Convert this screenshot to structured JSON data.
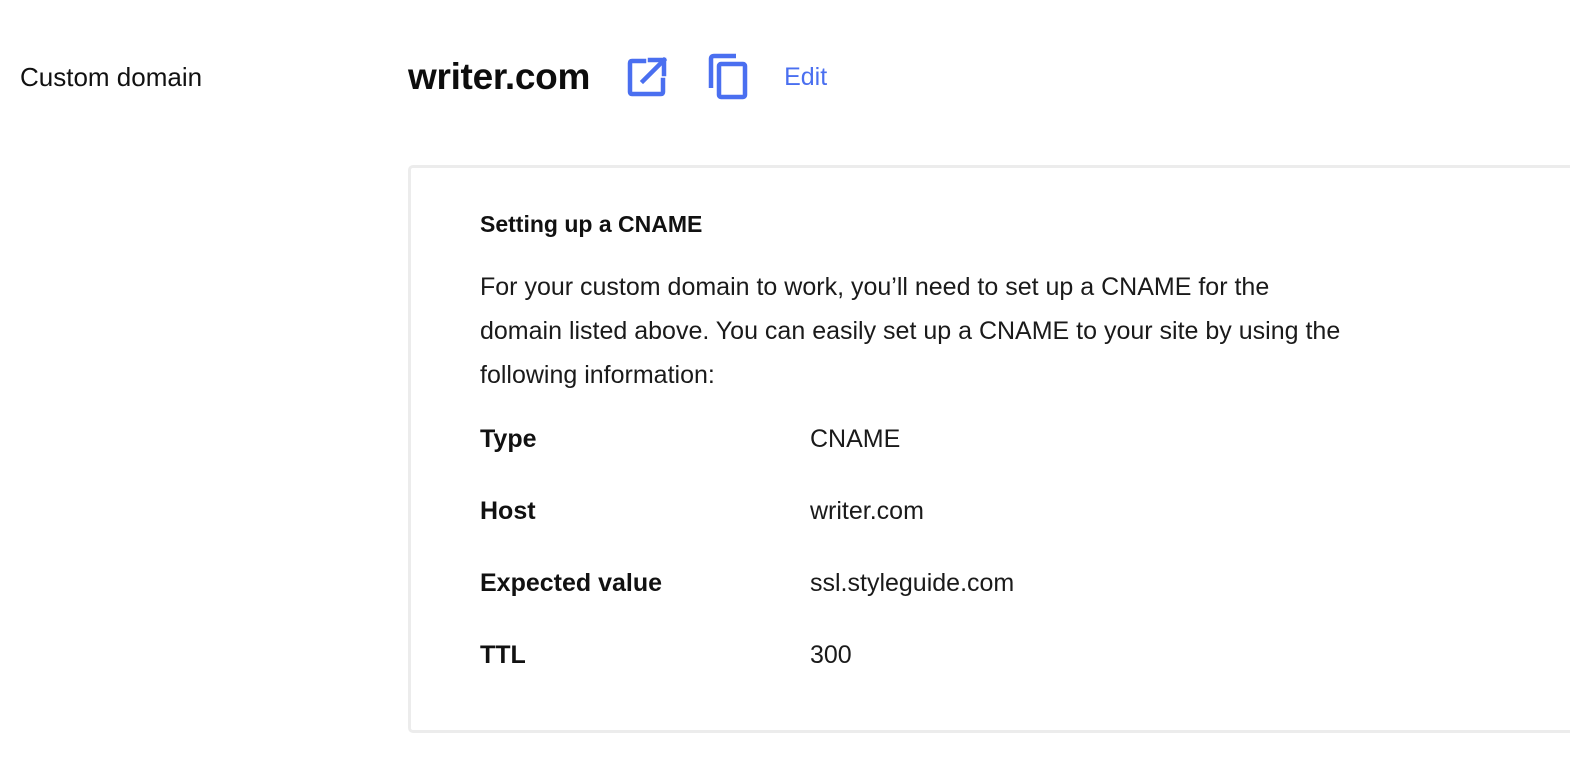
{
  "row": {
    "label": "Custom domain"
  },
  "domain": {
    "name": "writer.com",
    "edit_label": "Edit"
  },
  "icons": {
    "open": "open-in-new-icon",
    "copy": "copy-icon"
  },
  "colors": {
    "accent": "#4a6ff0",
    "card_border": "#ececec"
  },
  "card": {
    "title": "Setting up a CNAME",
    "description": "For your custom domain to work, you’ll need to set up a CNAME for the domain listed above. You can easily set up a CNAME to your site by using the following information:",
    "rows": [
      {
        "key": "Type",
        "value": "CNAME"
      },
      {
        "key": "Host",
        "value": "writer.com"
      },
      {
        "key": "Expected value",
        "value": "ssl.styleguide.com"
      },
      {
        "key": "TTL",
        "value": "300"
      }
    ]
  }
}
